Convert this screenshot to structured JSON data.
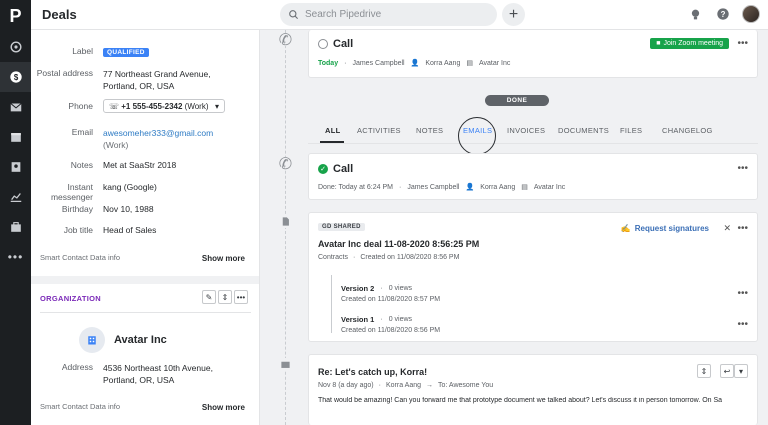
{
  "topbar": {
    "title": "Deals",
    "search_placeholder": "Search Pipedrive",
    "plus": "+"
  },
  "rail": {
    "logo": "P"
  },
  "person": {
    "label_label": "Label",
    "label_value": "QUALIFIED",
    "postal_label": "Postal address",
    "postal_line1": "77 Northeast Grand Avenue,",
    "postal_line2": "Portland, OR, USA",
    "phone_label": "Phone",
    "phone_value": "+1 555-455-2342",
    "phone_type": "(Work)",
    "email_label": "Email",
    "email_value": "awesomeher333@gmail.com",
    "email_type": "(Work)",
    "notes_label": "Notes",
    "notes_value": "Met at SaaStr 2018",
    "im_label": "Instant messenger",
    "im_value": "kang (Google)",
    "birthday_label": "Birthday",
    "birthday_value": "Nov 10, 1988",
    "job_label": "Job title",
    "job_value": "Head of Sales",
    "smart": "Smart Contact Data info",
    "show_more": "Show more"
  },
  "organization": {
    "title": "ORGANIZATION",
    "name": "Avatar Inc",
    "address_label": "Address",
    "address_line1": "4536 Northeast 10th Avenue,",
    "address_line2": "Portland, OR, USA",
    "smart": "Smart Contact Data info",
    "show_more": "Show more"
  },
  "activity1": {
    "title": "Call",
    "today": "Today",
    "person": "James Campbell",
    "owner": "Korra Aang",
    "org": "Avatar Inc",
    "zoom": "Join Zoom meeting",
    "more": "•••"
  },
  "done_label": "DONE",
  "tabs": [
    "ALL",
    "ACTIVITIES",
    "NOTES",
    "EMAILS",
    "INVOICES",
    "DOCUMENTS",
    "FILES",
    "CHANGELOG"
  ],
  "activity2": {
    "title": "Call",
    "done": "Done: Today at 6:24 PM",
    "person": "James Campbell",
    "owner": "Korra Aang",
    "org": "Avatar Inc",
    "more": "•••"
  },
  "document": {
    "badge": "SHARED",
    "title": "Avatar Inc deal 11-08-2020 8:56:25 PM",
    "type": "Contracts",
    "created": "Created on 11/08/2020 8:56 PM",
    "request": "Request signatures",
    "v2_title": "Version 2",
    "v2_views": "0 views",
    "v2_created": "Created on 11/08/2020 8:57 PM",
    "v1_title": "Version 1",
    "v1_views": "0 views",
    "v1_created": "Created on 11/08/2020 8:56 PM",
    "more": "•••"
  },
  "email": {
    "subject": "Re: Let's catch up, Korra!",
    "meta_date": "Nov 8 (a day ago)",
    "meta_from": "Korra Aang",
    "meta_to": "To: Awesome You",
    "body": "That would be amazing! Can you forward me that prototype document we talked about? Let's discuss it in person tomorrow. On Sa"
  },
  "colors": {
    "accent": "#3b82f6",
    "green": "#17a34a",
    "link": "#2e7bc4",
    "org_title": "#7b2ab8"
  }
}
